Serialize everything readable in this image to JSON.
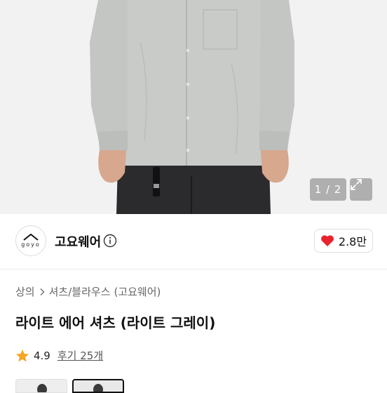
{
  "gallery": {
    "counter": "1 / 2",
    "expand_icon": "expand-icon"
  },
  "brand": {
    "logo_text": "goyo",
    "name": "고요웨어",
    "info_icon": "info-icon"
  },
  "like": {
    "icon": "heart-icon",
    "count": "2.8만",
    "color": "#e8232f"
  },
  "breadcrumb": {
    "items": [
      "상의",
      "셔츠/블라우스",
      "(고요웨어)"
    ],
    "separator_icon": "chevron-right-icon"
  },
  "product": {
    "title": "라이트 에어 셔츠 (라이트 그레이)"
  },
  "rating": {
    "star_icon": "star-icon",
    "star_color": "#f5a623",
    "value": "4.9",
    "review_label": "후기 25개"
  },
  "thumbnails": [
    {
      "icon": "product-thumbnail"
    },
    {
      "icon": "product-thumbnail",
      "selected": true
    }
  ]
}
